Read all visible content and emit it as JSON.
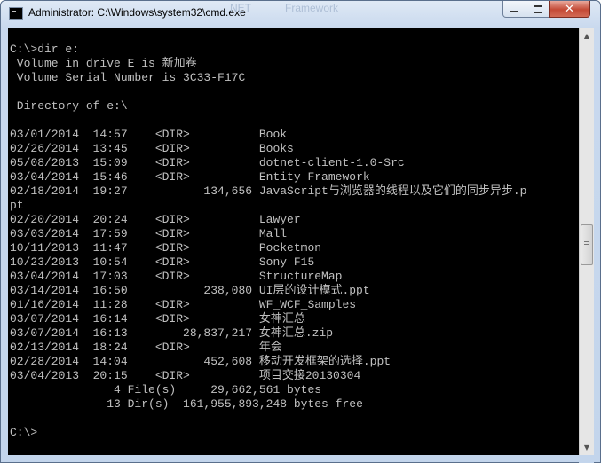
{
  "window": {
    "title": "Administrator: C:\\Windows\\system32\\cmd.exe",
    "faint_background_text": [
      "NET",
      "Framework"
    ]
  },
  "controls": {
    "minimize_icon": "minimize-icon",
    "maximize_icon": "maximize-icon",
    "close_icon": "close-icon",
    "close_glyph": "✕"
  },
  "console": {
    "lines": [
      "C:\\>dir e:",
      " Volume in drive E is 新加卷",
      " Volume Serial Number is 3C33-F17C",
      "",
      " Directory of e:\\",
      "",
      "03/01/2014  14:57    <DIR>          Book",
      "02/26/2014  13:45    <DIR>          Books",
      "05/08/2013  15:09    <DIR>          dotnet-client-1.0-Src",
      "03/04/2014  15:46    <DIR>          Entity Framework",
      "02/18/2014  19:27           134,656 JavaScript与浏览器的线程以及它们的同步异步.p",
      "pt",
      "02/20/2014  20:24    <DIR>          Lawyer",
      "03/03/2014  17:59    <DIR>          Mall",
      "10/11/2013  11:47    <DIR>          Pocketmon",
      "10/23/2013  10:54    <DIR>          Sony F15",
      "03/04/2014  17:03    <DIR>          StructureMap",
      "03/14/2014  16:50           238,080 UI层的设计模式.ppt",
      "01/16/2014  11:28    <DIR>          WF_WCF_Samples",
      "03/07/2014  16:14    <DIR>          女神汇总",
      "03/07/2014  16:13        28,837,217 女神汇总.zip",
      "02/13/2014  18:24    <DIR>          年会",
      "02/28/2014  14:04           452,608 移动开发框架的选择.ppt",
      "03/04/2013  20:15    <DIR>          项目交接20130304",
      "               4 File(s)     29,662,561 bytes",
      "              13 Dir(s)  161,955,893,248 bytes free",
      "",
      "C:\\>"
    ]
  },
  "scrollbar": {
    "up_arrow": "▲",
    "down_arrow": "▼"
  }
}
